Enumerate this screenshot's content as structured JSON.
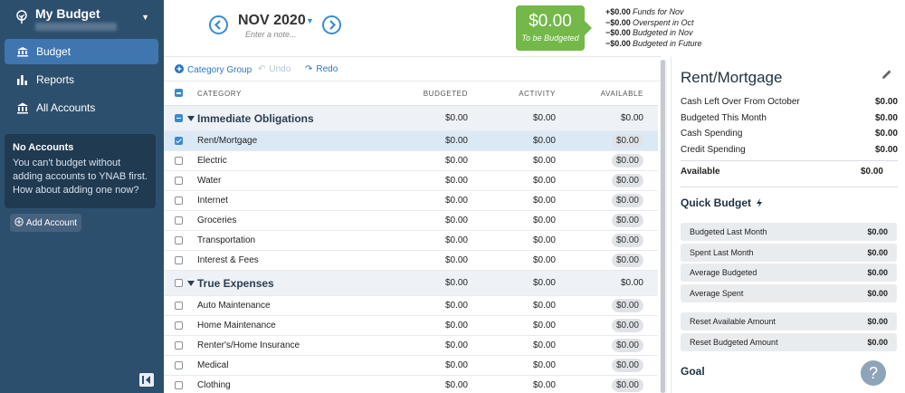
{
  "sidebar": {
    "budget_name": "My Budget",
    "nav": [
      {
        "label": "Budget",
        "icon": "bank-icon"
      },
      {
        "label": "Reports",
        "icon": "bar-chart-icon"
      },
      {
        "label": "All Accounts",
        "icon": "institution-icon"
      }
    ],
    "no_accounts_title": "No Accounts",
    "no_accounts_body": "You can't budget without adding accounts to YNAB first. How about adding one now?",
    "add_account_label": "Add Account"
  },
  "header": {
    "month": "NOV 2020",
    "note_placeholder": "Enter a note...",
    "to_be_budgeted_amount": "$0.00",
    "to_be_budgeted_label": "To be Budgeted",
    "funds": [
      {
        "amount": "+$0.00",
        "label": "Funds for Nov"
      },
      {
        "amount": "−$0.00",
        "label": "Overspent in Oct"
      },
      {
        "amount": "−$0.00",
        "label": "Budgeted in Nov"
      },
      {
        "amount": "−$0.00",
        "label": "Budgeted in Future"
      }
    ]
  },
  "toolbar": {
    "category_group": "Category Group",
    "undo": "Undo",
    "redo": "Redo"
  },
  "table": {
    "headers": {
      "category": "CATEGORY",
      "budgeted": "BUDGETED",
      "activity": "ACTIVITY",
      "available": "AVAILABLE"
    },
    "rows": [
      {
        "type": "group",
        "name": "Immediate Obligations",
        "budgeted": "$0.00",
        "activity": "$0.00",
        "available": "$0.00"
      },
      {
        "type": "cat",
        "name": "Rent/Mortgage",
        "budgeted": "$0.00",
        "activity": "$0.00",
        "available": "$0.00",
        "selected": true
      },
      {
        "type": "cat",
        "name": "Electric",
        "budgeted": "$0.00",
        "activity": "$0.00",
        "available": "$0.00"
      },
      {
        "type": "cat",
        "name": "Water",
        "budgeted": "$0.00",
        "activity": "$0.00",
        "available": "$0.00"
      },
      {
        "type": "cat",
        "name": "Internet",
        "budgeted": "$0.00",
        "activity": "$0.00",
        "available": "$0.00"
      },
      {
        "type": "cat",
        "name": "Groceries",
        "budgeted": "$0.00",
        "activity": "$0.00",
        "available": "$0.00"
      },
      {
        "type": "cat",
        "name": "Transportation",
        "budgeted": "$0.00",
        "activity": "$0.00",
        "available": "$0.00"
      },
      {
        "type": "cat",
        "name": "Interest & Fees",
        "budgeted": "$0.00",
        "activity": "$0.00",
        "available": "$0.00"
      },
      {
        "type": "group",
        "name": "True Expenses",
        "budgeted": "$0.00",
        "activity": "$0.00",
        "available": "$0.00"
      },
      {
        "type": "cat",
        "name": "Auto Maintenance",
        "budgeted": "$0.00",
        "activity": "$0.00",
        "available": "$0.00"
      },
      {
        "type": "cat",
        "name": "Home Maintenance",
        "budgeted": "$0.00",
        "activity": "$0.00",
        "available": "$0.00"
      },
      {
        "type": "cat",
        "name": "Renter's/Home Insurance",
        "budgeted": "$0.00",
        "activity": "$0.00",
        "available": "$0.00"
      },
      {
        "type": "cat",
        "name": "Medical",
        "budgeted": "$0.00",
        "activity": "$0.00",
        "available": "$0.00"
      },
      {
        "type": "cat",
        "name": "Clothing",
        "budgeted": "$0.00",
        "activity": "$0.00",
        "available": "$0.00"
      }
    ]
  },
  "inspector": {
    "title": "Rent/Mortgage",
    "rows": [
      {
        "label": "Cash Left Over From October",
        "value": "$0.00"
      },
      {
        "label": "Budgeted This Month",
        "value": "$0.00"
      },
      {
        "label": "Cash Spending",
        "value": "$0.00"
      },
      {
        "label": "Credit Spending",
        "value": "$0.00"
      }
    ],
    "available_label": "Available",
    "available_value": "$0.00",
    "quick_budget_title": "Quick Budget",
    "quick_budget": [
      {
        "label": "Budgeted Last Month",
        "value": "$0.00"
      },
      {
        "label": "Spent Last Month",
        "value": "$0.00"
      },
      {
        "label": "Average Budgeted",
        "value": "$0.00"
      },
      {
        "label": "Average Spent",
        "value": "$0.00"
      },
      {
        "label": "Reset Available Amount",
        "value": "$0.00"
      },
      {
        "label": "Reset Budgeted Amount",
        "value": "$0.00"
      }
    ],
    "goal_title": "Goal"
  },
  "help_label": "?",
  "colors": {
    "sidebar": "#2d4f6e",
    "accent": "#3a8bd0",
    "to_be_budgeted": "#74b84a"
  }
}
